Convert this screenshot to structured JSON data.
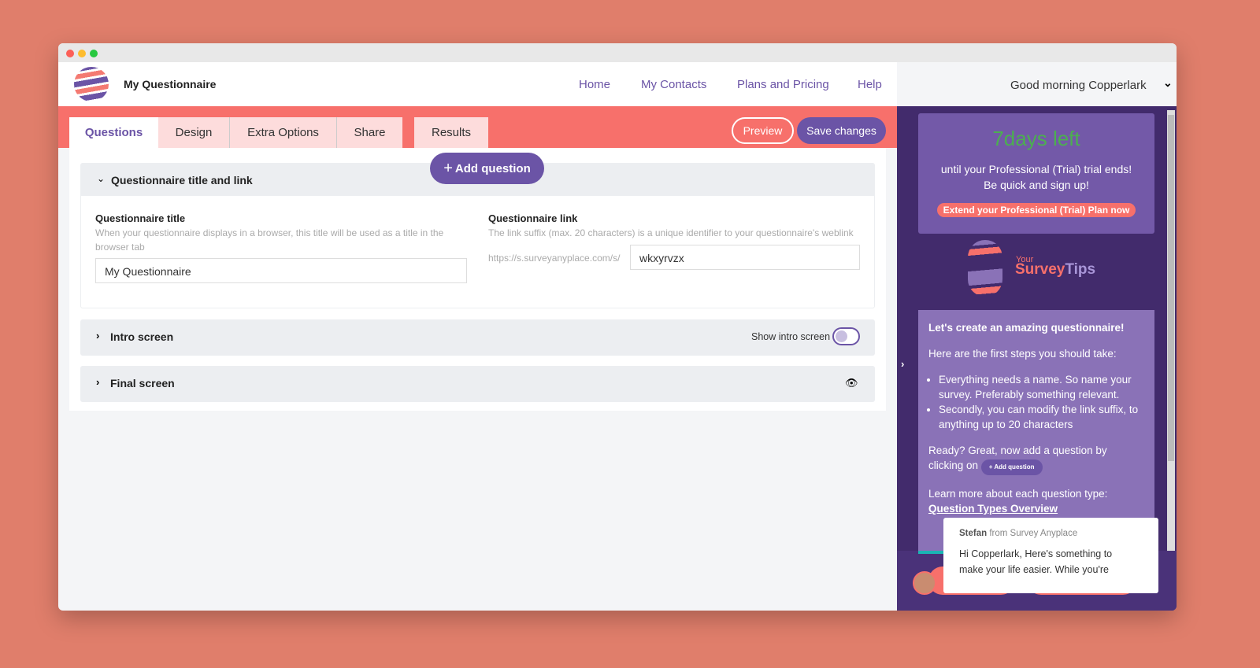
{
  "app": {
    "title": "My Questionnaire"
  },
  "nav": [
    "Home",
    "My Contacts",
    "Plans and Pricing",
    "Help"
  ],
  "greeting": "Good morning Copperlark",
  "tabs": [
    "Questions",
    "Design",
    "Extra Options",
    "Share",
    "Results"
  ],
  "actions": {
    "preview": "Preview",
    "save": "Save changes",
    "add_question": "Add question"
  },
  "sections": {
    "title_link": {
      "heading": "Questionnaire title and link",
      "title_label": "Questionnaire title",
      "title_help": "When your questionnaire displays in a browser, this title will be used as a title in the browser tab",
      "title_value": "My Questionnaire",
      "link_label": "Questionnaire link",
      "link_help": "The link suffix (max. 20 characters) is a unique identifier to your questionnaire's weblink",
      "link_prefix": "https://s.surveyanyplace.com/s/",
      "link_value": "wkxyrvzx"
    },
    "intro": {
      "heading": "Intro screen",
      "toggle_label": "Show intro screen",
      "toggle_on": true
    },
    "final": {
      "heading": "Final screen"
    }
  },
  "sidebar": {
    "days_left": "7days left",
    "trial_text": "until your Professional (Trial) trial ends! Be quick and sign up!",
    "extend": "Extend your Professional (Trial) Plan now",
    "tips_logo": {
      "your": "Your",
      "survey": "Survey",
      "tips": "Tips"
    },
    "tips_heading": "Let's create an amazing questionnaire!",
    "tips_intro": "Here are the first steps you should take:",
    "tips_steps": [
      "Everything needs a name. So name your survey. Preferably something relevant.",
      "Secondly, you can modify the link suffix, to anything up to 20 characters"
    ],
    "ready_text": "Ready? Great, now add a question by clicking on",
    "ready_button": "+ Add question",
    "learn_text": "Learn more about each question type:",
    "learn_link": "Question Types Overview"
  },
  "chat": {
    "sender": "Stefan",
    "from": "from Survey Anyplace",
    "message": "Hi Copperlark, Here's something to make your life easier.  While you're"
  },
  "colors": {
    "accent": "#6b54a6",
    "coral": "#f7706b",
    "green": "#4caf50"
  }
}
